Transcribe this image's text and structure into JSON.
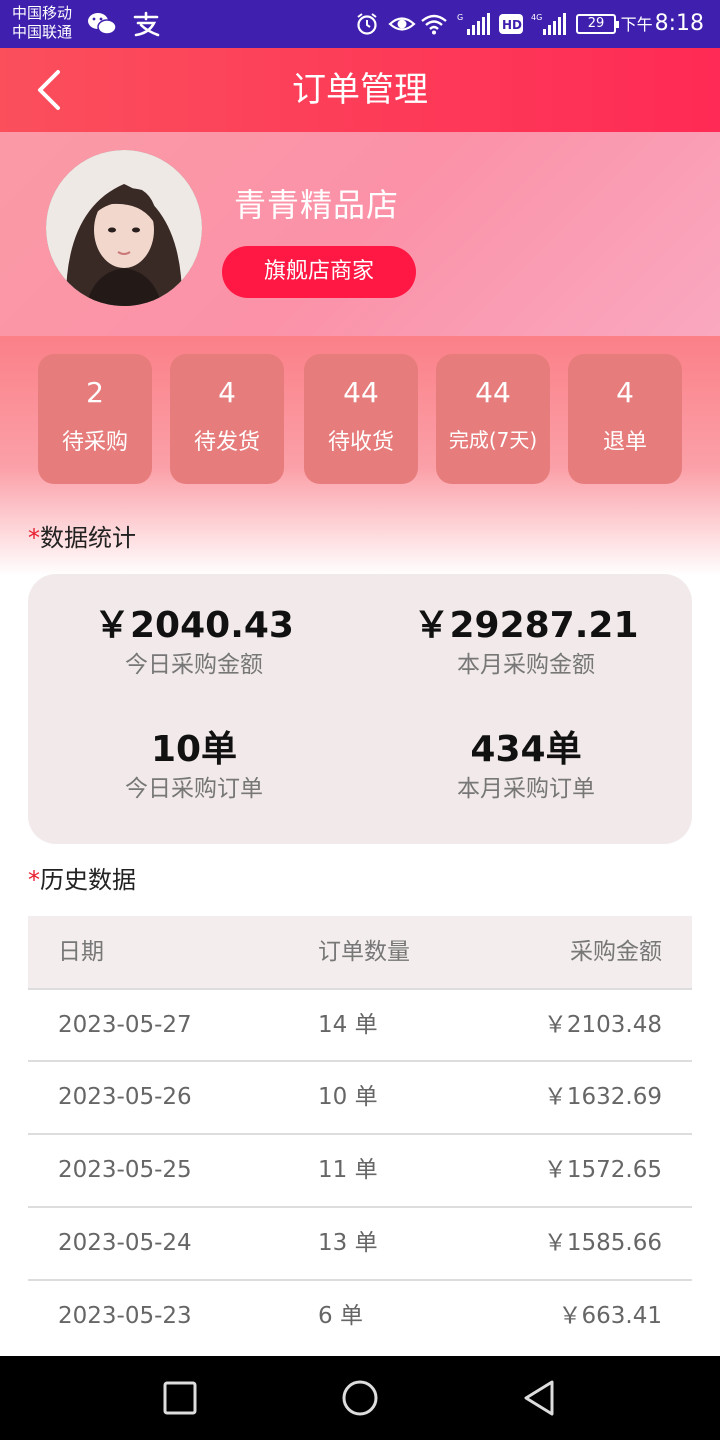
{
  "status_bar": {
    "carrier_1": "中国移动",
    "carrier_2": "中国联通",
    "battery": "29",
    "time_prefix": "下午",
    "time": "8:18"
  },
  "header": {
    "title": "订单管理"
  },
  "profile": {
    "shop_name": "青青精品店",
    "badge": "旗舰店商家"
  },
  "order_tiles": [
    {
      "count": "2",
      "label": "待采购"
    },
    {
      "count": "4",
      "label": "待发货"
    },
    {
      "count": "44",
      "label": "待收货"
    },
    {
      "count": "44",
      "label": "完成(7天)"
    },
    {
      "count": "4",
      "label": "退单"
    }
  ],
  "stats": {
    "section_star": "*",
    "section_title": "数据统计",
    "items": [
      {
        "value": "￥2040.43",
        "label": "今日采购金额"
      },
      {
        "value": "￥29287.21",
        "label": "本月采购金额"
      },
      {
        "value": "10单",
        "label": "今日采购订单"
      },
      {
        "value": "434单",
        "label": "本月采购订单"
      }
    ]
  },
  "history": {
    "section_star": "*",
    "section_title": "历史数据",
    "columns": [
      "日期",
      "订单数量",
      "采购金额"
    ],
    "rows": [
      {
        "date": "2023-05-27",
        "orders": "14 单",
        "amount": "￥2103.48"
      },
      {
        "date": "2023-05-26",
        "orders": "10 单",
        "amount": "￥1632.69"
      },
      {
        "date": "2023-05-25",
        "orders": "11 单",
        "amount": "￥1572.65"
      },
      {
        "date": "2023-05-24",
        "orders": "13 单",
        "amount": "￥1585.66"
      },
      {
        "date": "2023-05-23",
        "orders": "6 单",
        "amount": "￥663.41"
      }
    ]
  },
  "icons": {
    "status_bar": [
      "wechat-icon",
      "alipay-icon",
      "alarm-icon",
      "eye-icon",
      "wifi-icon",
      "signal-icon",
      "hd-icon",
      "signal-4g-icon",
      "battery-icon"
    ],
    "header": [
      "back-icon"
    ],
    "nav_bar": [
      "recent-apps-icon",
      "home-icon",
      "back-icon"
    ]
  },
  "colors": {
    "status_bar": "#3f1fae",
    "header": "#ff2a55",
    "badge": "#ff1843",
    "tile": "#e77c7c",
    "accent_star": "#e81e2e",
    "card": "#f2eaea"
  }
}
